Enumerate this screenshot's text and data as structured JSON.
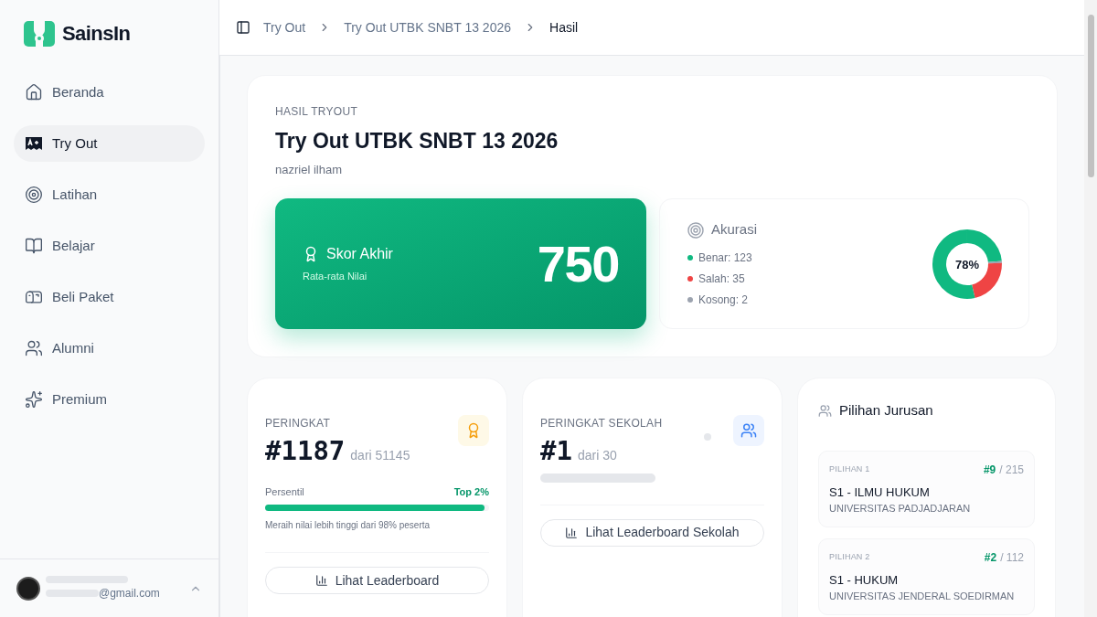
{
  "brand": {
    "name": "SainsIn"
  },
  "sidebar": {
    "items": [
      {
        "label": "Beranda",
        "selected": false
      },
      {
        "label": "Try Out",
        "selected": true
      },
      {
        "label": "Latihan",
        "selected": false
      },
      {
        "label": "Belajar",
        "selected": false
      },
      {
        "label": "Beli Paket",
        "selected": false
      },
      {
        "label": "Alumni",
        "selected": false
      },
      {
        "label": "Premium",
        "selected": false
      }
    ],
    "user": {
      "email": "@gmail.com"
    }
  },
  "breadcrumb": [
    "Try Out",
    "Try Out UTBK SNBT 13 2026",
    "Hasil"
  ],
  "result": {
    "eyebrow": "HASIL TRYOUT",
    "title": "Try Out UTBK SNBT 13 2026",
    "name": "nazriel ilham",
    "score": {
      "label": "Skor Akhir",
      "sublabel": "Rata-rata Nilai",
      "value": "750"
    },
    "accuracy": {
      "title": "Akurasi",
      "center": "78%",
      "legend": [
        {
          "label": "Benar: 123",
          "color": "#10b981"
        },
        {
          "label": "Salah: 35",
          "color": "#ef4444"
        },
        {
          "label": "Kosong: 2",
          "color": "#9ca3af"
        }
      ]
    }
  },
  "rank": {
    "label": "PERINGKAT",
    "value": "#1187",
    "total": "dari 51145",
    "percentile_label": "Persentil",
    "percentile": "Top 2%",
    "level": 0.98,
    "note": "Meraih nilai lebih tinggi dari 98% peserta",
    "button": "Lihat Leaderboard"
  },
  "school_rank": {
    "label": "PERINGKAT SEKOLAH",
    "value": "#1",
    "total": "dari 30",
    "button": "Lihat Leaderboard Sekolah"
  },
  "choices": {
    "title": "Pilihan Jurusan",
    "items": [
      {
        "label": "PILIHAN 1",
        "rank": "#9",
        "total": "/ 215",
        "major": "S1 - ILMU HUKUM",
        "university": "UNIVERSITAS PADJADJARAN"
      },
      {
        "label": "PILIHAN 2",
        "rank": "#2",
        "total": "/ 112",
        "major": "S1 - HUKUM",
        "university": "UNIVERSITAS JENDERAL SOEDIRMAN"
      }
    ]
  }
}
